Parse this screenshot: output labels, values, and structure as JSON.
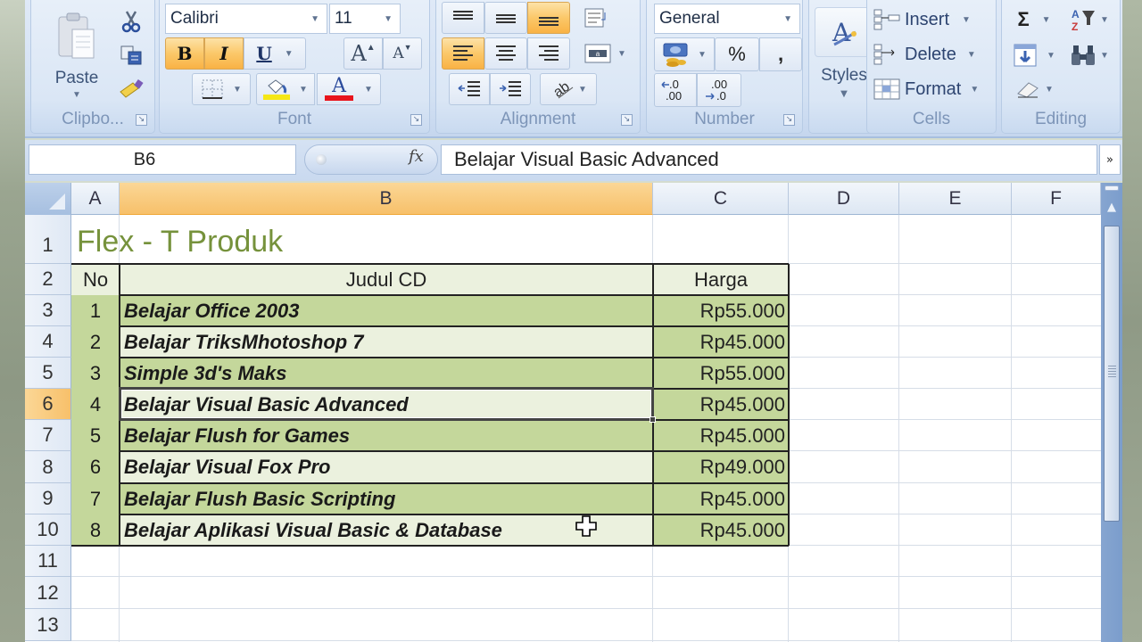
{
  "ribbon": {
    "clipboard": {
      "label": "Clipbo...",
      "paste_label": "Paste",
      "icons": [
        "paste-icon",
        "cut-icon",
        "copy-icon",
        "format-painter-icon"
      ]
    },
    "font": {
      "label": "Font",
      "font_name": "Calibri",
      "font_size": "11",
      "bold_label": "B",
      "italic_label": "I",
      "underline_label": "U",
      "grow_label": "A",
      "shrink_label": "A",
      "fill_color": "#f5e716",
      "font_color": "#e8141c",
      "bold_active": true,
      "italic_active": true
    },
    "alignment": {
      "label": "Alignment",
      "active_vertical": "bottom",
      "active_horizontal": "left"
    },
    "number": {
      "label": "Number",
      "format": "General",
      "percent_label": "%",
      "comma_label": ",",
      "inc_decimal_label": "+.0 .00",
      "dec_decimal_label": ".00 →.0"
    },
    "styles": {
      "label": "Styles"
    },
    "cells": {
      "label": "Cells",
      "insert_label": "Insert",
      "delete_label": "Delete",
      "format_label": "Format"
    },
    "editing": {
      "label": "Editing",
      "sum_label": "Σ"
    }
  },
  "formula_bar": {
    "name_box": "B6",
    "fx_label": "fx",
    "formula": "Belajar Visual Basic Advanced"
  },
  "sheet": {
    "columns": [
      "A",
      "B",
      "C",
      "D",
      "E",
      "F"
    ],
    "selected_column": "B",
    "rows": [
      "1",
      "2",
      "3",
      "4",
      "5",
      "6",
      "7",
      "8",
      "9",
      "10",
      "11",
      "12",
      "13"
    ],
    "selected_row": "6",
    "title": "Flex - T Produk",
    "headers": {
      "no": "No",
      "title": "Judul CD",
      "price": "Harga"
    },
    "records": [
      {
        "no": "1",
        "title": "Belajar Office 2003",
        "price": "Rp55.000"
      },
      {
        "no": "2",
        "title": "Belajar TriksMhotoshop 7",
        "price": "Rp45.000"
      },
      {
        "no": "3",
        "title": "Simple 3d's Maks",
        "price": "Rp55.000"
      },
      {
        "no": "4",
        "title": "Belajar Visual Basic Advanced",
        "price": "Rp45.000"
      },
      {
        "no": "5",
        "title": "Belajar Flush for Games",
        "price": "Rp45.000"
      },
      {
        "no": "6",
        "title": "Belajar Visual Fox Pro",
        "price": "Rp49.000"
      },
      {
        "no": "7",
        "title": "Belajar Flush Basic Scripting",
        "price": "Rp45.000"
      },
      {
        "no": "8",
        "title": "Belajar Aplikasi Visual Basic & Database",
        "price": "Rp45.000"
      }
    ],
    "colors": {
      "band_dark": "#c4d79b",
      "band_light": "#ebf1de",
      "title_color": "#76923c",
      "selection_header": "#f7c06a"
    }
  }
}
